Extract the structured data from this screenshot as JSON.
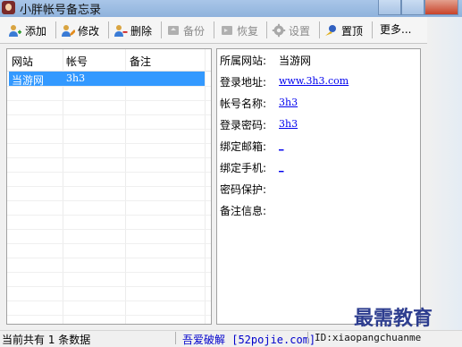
{
  "window": {
    "title": "小胖帐号备忘录"
  },
  "toolbar": {
    "items": [
      {
        "label": "添加",
        "icon": "add-user-icon",
        "enabled": true
      },
      {
        "label": "修改",
        "icon": "edit-user-icon",
        "enabled": true
      },
      {
        "label": "删除",
        "icon": "delete-user-icon",
        "enabled": true
      },
      {
        "label": "备份",
        "icon": "backup-icon",
        "enabled": false
      },
      {
        "label": "恢复",
        "icon": "restore-icon",
        "enabled": false
      },
      {
        "label": "设置",
        "icon": "gear-icon",
        "enabled": false
      },
      {
        "label": "置顶",
        "icon": "pin-icon",
        "enabled": true
      }
    ],
    "more_label": "更多..."
  },
  "list": {
    "columns": [
      "网站",
      "帐号",
      "备注"
    ],
    "rows": [
      {
        "site": "当游网",
        "account": "3h3",
        "note": "",
        "selected": true
      }
    ]
  },
  "detail": {
    "site_label": "所属网站:",
    "site_value": "当游网",
    "url_label": "登录地址:",
    "url_value": "www.3h3.com",
    "name_label": "帐号名称:",
    "name_value": "3h3",
    "password_label": "登录密码:",
    "password_value": "3h3",
    "email_label": "绑定邮箱:",
    "email_value": "_",
    "phone_label": "绑定手机:",
    "phone_value": "_",
    "protect_label": "密码保护:",
    "note_label": "备注信息:"
  },
  "status": {
    "count_text": "当前共有 1 条数据",
    "credit_text": "吾爱破解 [52pojie.com]",
    "id_text": "ID:xiaopangchuanme"
  },
  "watermark": "最需教育"
}
